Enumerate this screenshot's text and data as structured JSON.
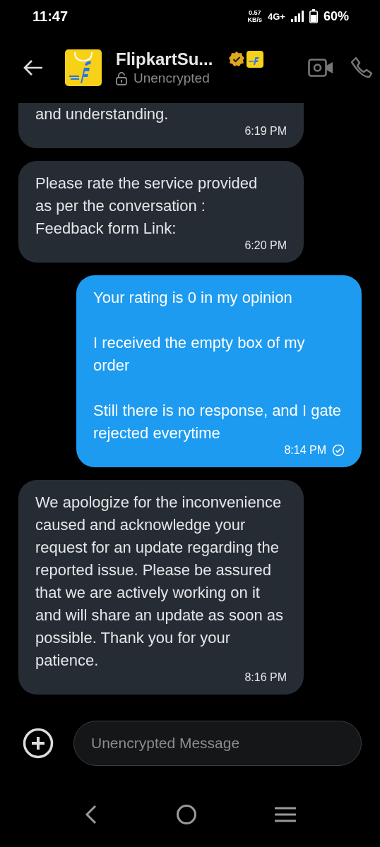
{
  "status_bar": {
    "time": "11:47",
    "speed_value": "0.57",
    "speed_unit": "KB/s",
    "network": "4G+",
    "battery": "60%"
  },
  "header": {
    "title": "FlipkartSu...",
    "subtitle": "Unencrypted",
    "verified": true
  },
  "messages": [
    {
      "kind": "incoming",
      "cut": true,
      "text": "and understanding.",
      "time": "6:19 PM"
    },
    {
      "kind": "incoming",
      "cut": false,
      "text": "Please rate the service provided\nas per the conversation :\nFeedback form Link:",
      "time": "6:20 PM"
    },
    {
      "kind": "outgoing",
      "cut": false,
      "text": "Your rating is 0 in my opinion\n\nI received the empty box of my order\n\nStill there is no response, and I gate rejected everytime",
      "time": "8:14 PM",
      "delivered": true
    },
    {
      "kind": "incoming",
      "cut": false,
      "text": "We apologize for the inconvenience caused and acknowledge your request for an update regarding the reported issue. Please be assured that we are actively working on it and will share an update as soon as possible. Thank you for your patience.",
      "time": "8:16 PM"
    }
  ],
  "composer": {
    "placeholder": "Unencrypted Message"
  }
}
